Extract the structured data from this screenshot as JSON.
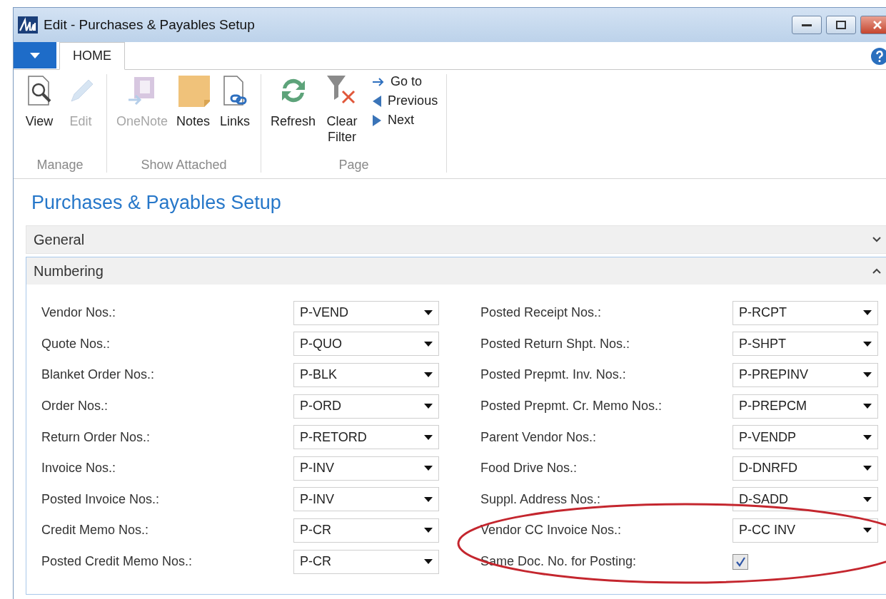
{
  "window": {
    "title": "Edit - Purchases & Payables Setup"
  },
  "ribbon": {
    "tabs": [
      {
        "label": "HOME",
        "selected": true
      }
    ],
    "groups": [
      {
        "label": "Manage",
        "buttons": [
          {
            "label": "View",
            "kind": "large",
            "disabled": false
          },
          {
            "label": "Edit",
            "kind": "large",
            "disabled": true
          }
        ]
      },
      {
        "label": "Show Attached",
        "buttons": [
          {
            "label": "OneNote",
            "kind": "large",
            "disabled": true
          },
          {
            "label": "Notes",
            "kind": "large",
            "disabled": false
          },
          {
            "label": "Links",
            "kind": "large",
            "disabled": false
          }
        ]
      },
      {
        "label": "Page",
        "buttons": [
          {
            "label": "Refresh",
            "kind": "large",
            "disabled": false
          },
          {
            "label": "Clear Filter",
            "kind": "large",
            "disabled": false
          },
          {
            "label": "Go to",
            "kind": "small",
            "disabled": false
          },
          {
            "label": "Previous",
            "kind": "small",
            "disabled": false
          },
          {
            "label": "Next",
            "kind": "small",
            "disabled": false
          }
        ]
      }
    ]
  },
  "page": {
    "title": "Purchases & Payables Setup"
  },
  "sections": [
    {
      "title": "General",
      "expanded": false
    },
    {
      "title": "Numbering",
      "expanded": true,
      "left": [
        {
          "label": "Vendor Nos.:",
          "kind": "dropdown",
          "value": "P-VEND"
        },
        {
          "label": "Quote Nos.:",
          "kind": "dropdown",
          "value": "P-QUO"
        },
        {
          "label": "Blanket Order Nos.:",
          "kind": "dropdown",
          "value": "P-BLK"
        },
        {
          "label": "Order Nos.:",
          "kind": "dropdown",
          "value": "P-ORD"
        },
        {
          "label": "Return Order Nos.:",
          "kind": "dropdown",
          "value": "P-RETORD"
        },
        {
          "label": "Invoice Nos.:",
          "kind": "dropdown",
          "value": "P-INV"
        },
        {
          "label": "Posted Invoice Nos.:",
          "kind": "dropdown",
          "value": "P-INV"
        },
        {
          "label": "Credit Memo Nos.:",
          "kind": "dropdown",
          "value": "P-CR"
        },
        {
          "label": "Posted Credit Memo Nos.:",
          "kind": "dropdown",
          "value": "P-CR"
        }
      ],
      "right": [
        {
          "label": "Posted Receipt Nos.:",
          "kind": "dropdown",
          "value": "P-RCPT"
        },
        {
          "label": "Posted Return Shpt. Nos.:",
          "kind": "dropdown",
          "value": "P-SHPT"
        },
        {
          "label": "Posted Prepmt. Inv. Nos.:",
          "kind": "dropdown",
          "value": "P-PREPINV"
        },
        {
          "label": "Posted Prepmt. Cr. Memo Nos.:",
          "kind": "dropdown",
          "value": "P-PREPCM"
        },
        {
          "label": "Parent Vendor Nos.:",
          "kind": "dropdown",
          "value": "P-VENDP"
        },
        {
          "label": "Food Drive Nos.:",
          "kind": "dropdown",
          "value": "D-DNRFD"
        },
        {
          "label": "Suppl. Address Nos.:",
          "kind": "dropdown",
          "value": "D-SADD"
        },
        {
          "label": "Vendor CC Invoice Nos.:",
          "kind": "dropdown",
          "value": "P-CC INV"
        },
        {
          "label": "Same Doc. No. for Posting:",
          "kind": "checkbox",
          "checked": true
        }
      ]
    }
  ]
}
